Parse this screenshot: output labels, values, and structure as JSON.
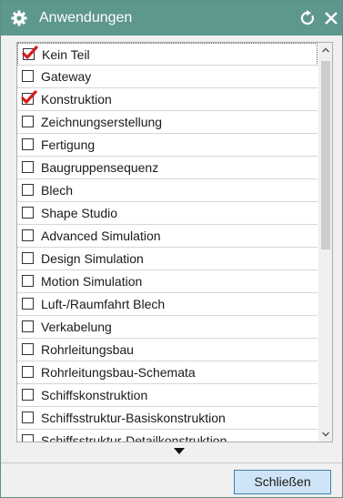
{
  "window": {
    "title": "Anwendungen"
  },
  "applications": [
    {
      "label": "Kein Teil",
      "checked": true
    },
    {
      "label": "Gateway",
      "checked": false
    },
    {
      "label": "Konstruktion",
      "checked": true
    },
    {
      "label": "Zeichnungserstellung",
      "checked": false
    },
    {
      "label": "Fertigung",
      "checked": false
    },
    {
      "label": "Baugruppensequenz",
      "checked": false
    },
    {
      "label": "Blech",
      "checked": false
    },
    {
      "label": "Shape Studio",
      "checked": false
    },
    {
      "label": "Advanced Simulation",
      "checked": false
    },
    {
      "label": "Design Simulation",
      "checked": false
    },
    {
      "label": "Motion Simulation",
      "checked": false
    },
    {
      "label": "Luft-/Raumfahrt Blech",
      "checked": false
    },
    {
      "label": "Verkabelung",
      "checked": false
    },
    {
      "label": "Rohrleitungsbau",
      "checked": false
    },
    {
      "label": "Rohrleitungsbau-Schemata",
      "checked": false
    },
    {
      "label": "Schiffskonstruktion",
      "checked": false
    },
    {
      "label": "Schiffsstruktur-Basiskonstruktion",
      "checked": false
    },
    {
      "label": "Schiffsstruktur-Detailkonstruktion",
      "checked": false
    }
  ],
  "buttons": {
    "close_label": "Schließen"
  },
  "icons": {
    "title": "gear-icon",
    "reset": "reset-icon",
    "close": "close-icon",
    "check": "checkmark-icon",
    "expand": "triangle-down-icon"
  },
  "colors": {
    "titlebar": "#5e978d",
    "checkmark": "#d21f1f",
    "button_bg": "#cfe5f7",
    "button_border": "#3c7fb1"
  }
}
